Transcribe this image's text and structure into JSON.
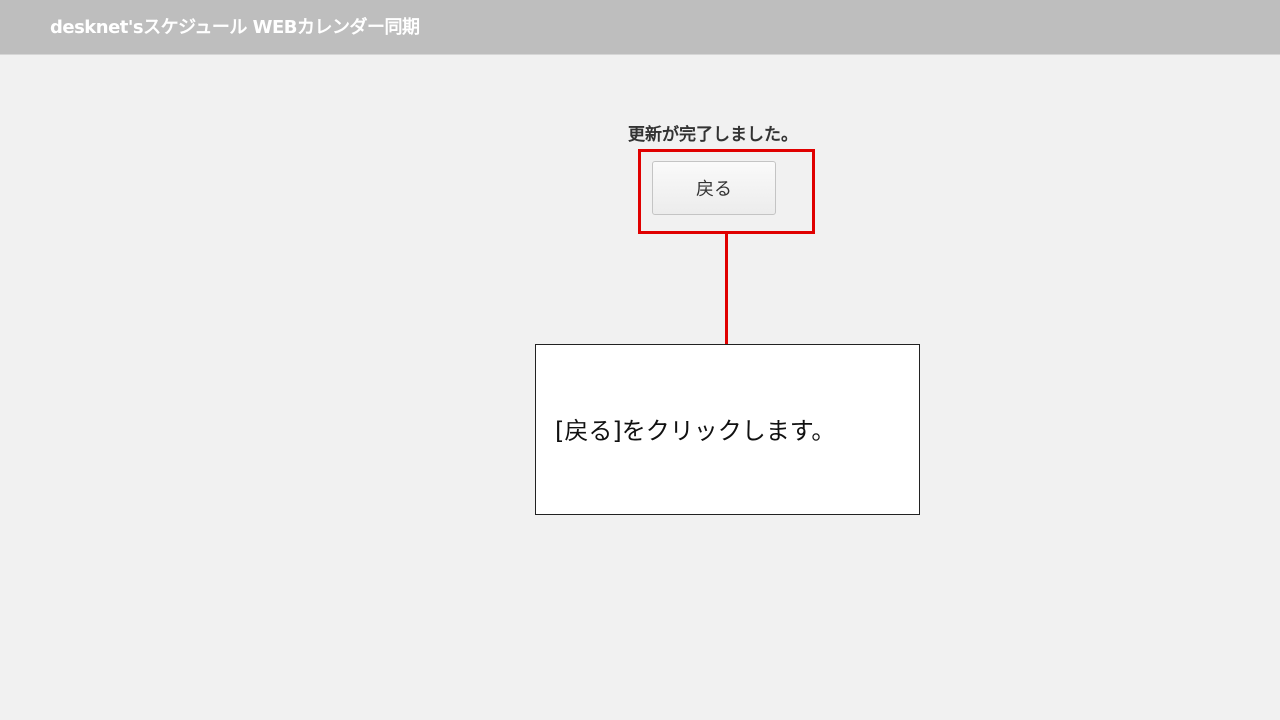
{
  "header": {
    "title": "desknet'sスケジュール WEBカレンダー同期"
  },
  "main": {
    "message": "更新が完了しました。",
    "back_button_label": "戻る"
  },
  "annotation": {
    "callout_text": "[戻る]をクリックします。",
    "highlight_color": "#e00000"
  },
  "colors": {
    "header_bg": "#bebebe",
    "page_bg": "#f1f1f1"
  }
}
